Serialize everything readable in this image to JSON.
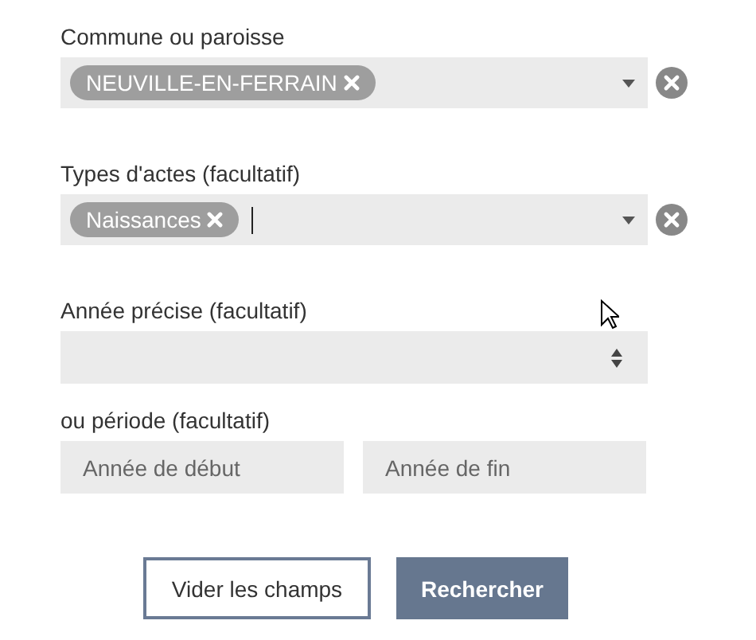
{
  "commune": {
    "label": "Commune ou paroisse",
    "tags": [
      "NEUVILLE-EN-FERRAIN"
    ],
    "focused": false
  },
  "types": {
    "label": "Types d'actes (facultatif)",
    "tags": [
      "Naissances"
    ],
    "focused": true
  },
  "annee": {
    "label": "Année précise (facultatif)"
  },
  "periode": {
    "label": "ou période (facultatif)",
    "debut_placeholder": "Année de début",
    "fin_placeholder": "Année de fin"
  },
  "buttons": {
    "clear": "Vider les champs",
    "search": "Rechercher"
  }
}
